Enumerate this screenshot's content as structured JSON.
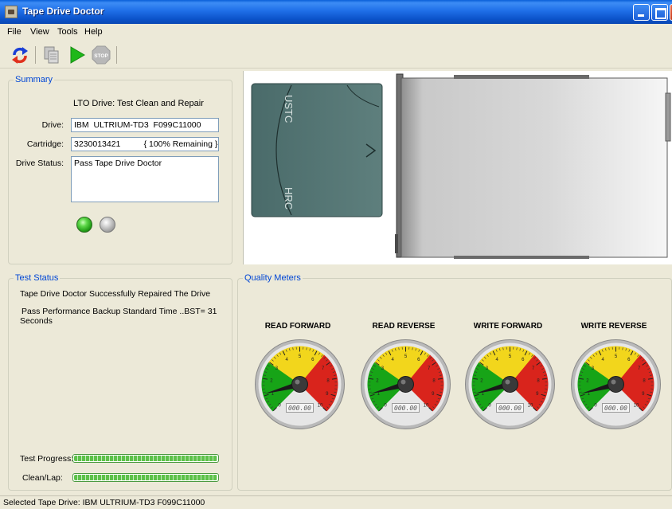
{
  "window": {
    "title": "Tape Drive Doctor"
  },
  "menu": {
    "items": [
      "File",
      "View",
      "Tools",
      "Help"
    ]
  },
  "toolbar": {
    "icons": [
      "refresh-icon",
      "copy-icon",
      "play-icon",
      "stop-icon"
    ],
    "stop_label": "STOP"
  },
  "summary": {
    "group_title": "Summary",
    "heading": "LTO Drive: Test Clean and Repair",
    "drive_label": "Drive:",
    "drive_value": "IBM  ULTRIUM-TD3  F099C11000",
    "cartridge_label": "Cartridge:",
    "cartridge_value": "3230013421          { 100% Remaining }",
    "status_label": "Drive Status:",
    "status_value": "Pass Tape Drive Doctor",
    "leds": [
      "green",
      "gray"
    ]
  },
  "cartridge_image": {
    "top_text": "USTC",
    "bottom_text": "HRC"
  },
  "test_status": {
    "group_title": "Test Status",
    "line1": "Tape Drive Doctor Successfully Repaired The Drive",
    "line2a": "Pass Performance Backup Standard Time ..BST= 31",
    "line2b": "Seconds",
    "progress_label": "Test Progress:",
    "progress_value": 1.0,
    "clean_label": "Clean/Lap:",
    "clean_value": 1.0
  },
  "quality": {
    "group_title": "Quality Meters",
    "gauges": [
      {
        "label": "READ FORWARD",
        "readout": "000.00"
      },
      {
        "label": "READ REVERSE",
        "readout": "000.00"
      },
      {
        "label": "WRITE FORWARD",
        "readout": "000.00"
      },
      {
        "label": "WRITE REVERSE",
        "readout": "000.00"
      }
    ],
    "scale": [
      "0",
      "1",
      "2",
      "3",
      "4",
      "5",
      "6",
      "7",
      "8",
      "9",
      "10"
    ]
  },
  "statusbar": {
    "text": "Selected Tape Drive: IBM  ULTRIUM-TD3  F099C11000"
  },
  "colors": {
    "accent": "#0046d5",
    "titlebar": "#0a5fd8",
    "led_green": "#1f9a14",
    "progress": "#5ec24a"
  }
}
